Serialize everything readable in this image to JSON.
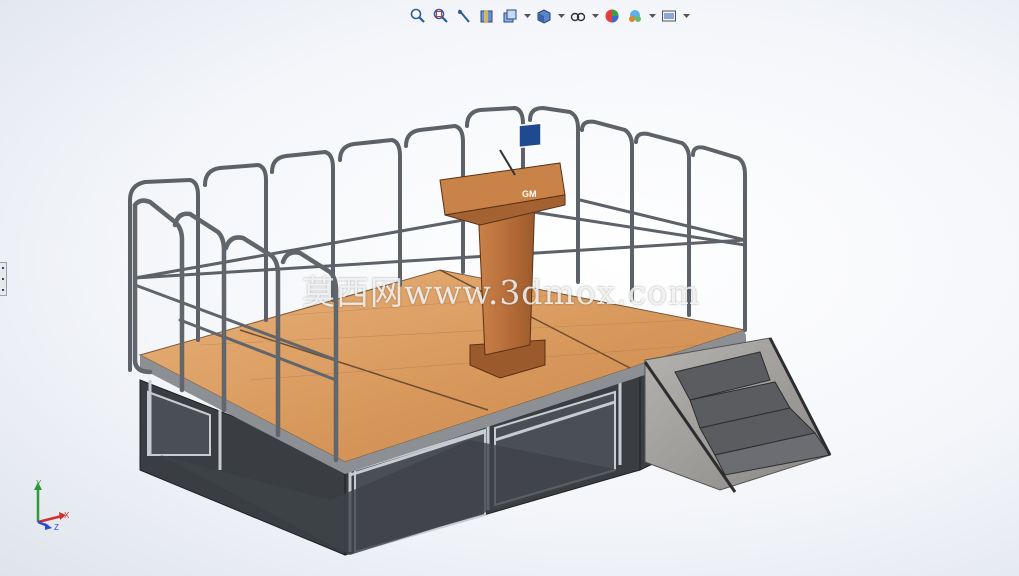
{
  "toolbar": {
    "buttons": [
      {
        "icon": "zoom-to-fit-icon"
      },
      {
        "icon": "zoom-to-area-icon"
      },
      {
        "icon": "previous-view-icon"
      },
      {
        "icon": "section-view-icon"
      },
      {
        "icon": "view-orientation-icon",
        "dropdown": true
      },
      {
        "icon": "display-style-icon",
        "dropdown": true
      },
      {
        "icon": "hide-show-items-icon",
        "dropdown": true
      },
      {
        "icon": "edit-appearance-icon"
      },
      {
        "icon": "apply-scene-icon",
        "dropdown": true
      },
      {
        "icon": "view-settings-icon",
        "dropdown": true
      }
    ]
  },
  "model": {
    "podium_badge": "GM"
  },
  "watermark": "莫西网www.3dmox.com",
  "triad": {
    "x_label": "X",
    "y_label": "Y",
    "z_label": "Z"
  },
  "colors": {
    "deck": "#d99a5e",
    "frame": "#6f737a",
    "podium": "#b86e3a",
    "badge": "#1f4a8f",
    "stairs": "#9c9a96"
  }
}
